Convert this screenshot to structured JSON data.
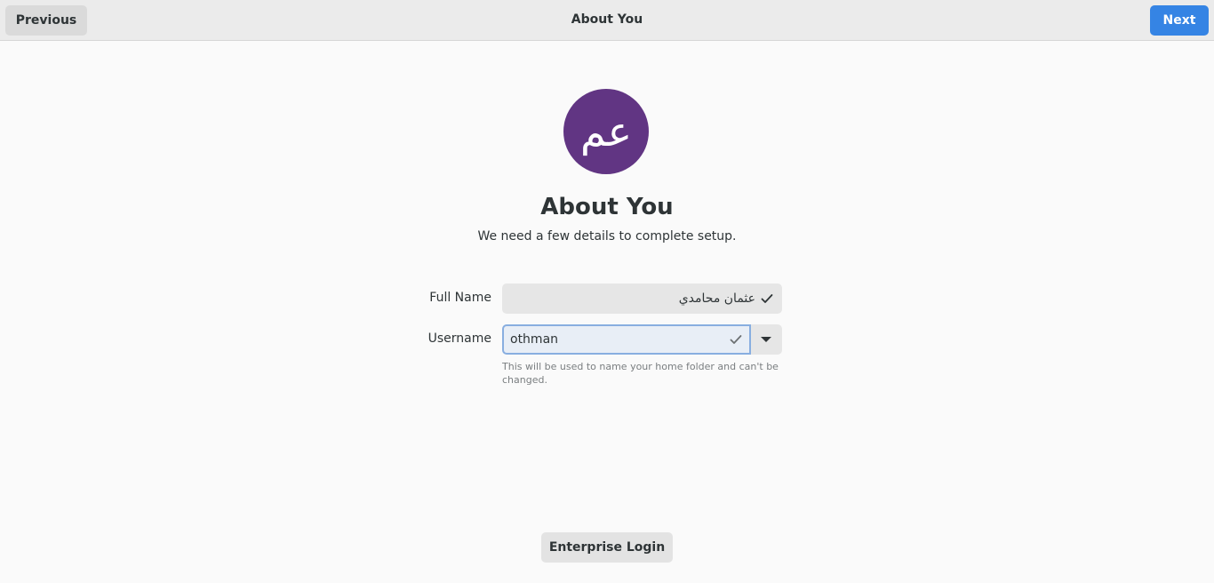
{
  "header": {
    "title": "About You",
    "previous_label": "Previous",
    "next_label": "Next"
  },
  "avatar": {
    "initials": "عم",
    "color": "#613583"
  },
  "main": {
    "title": "About You",
    "subtitle": "We need a few details to complete setup."
  },
  "form": {
    "full_name_label": "Full Name",
    "full_name_value": "عثمان محامدي",
    "username_label": "Username",
    "username_value": "othman",
    "username_hint": "This will be used to name your home folder and can't be changed."
  },
  "footer": {
    "enterprise_login_label": "Enterprise Login"
  },
  "colors": {
    "accent": "#3584e4",
    "focus_border": "#88aee0"
  }
}
